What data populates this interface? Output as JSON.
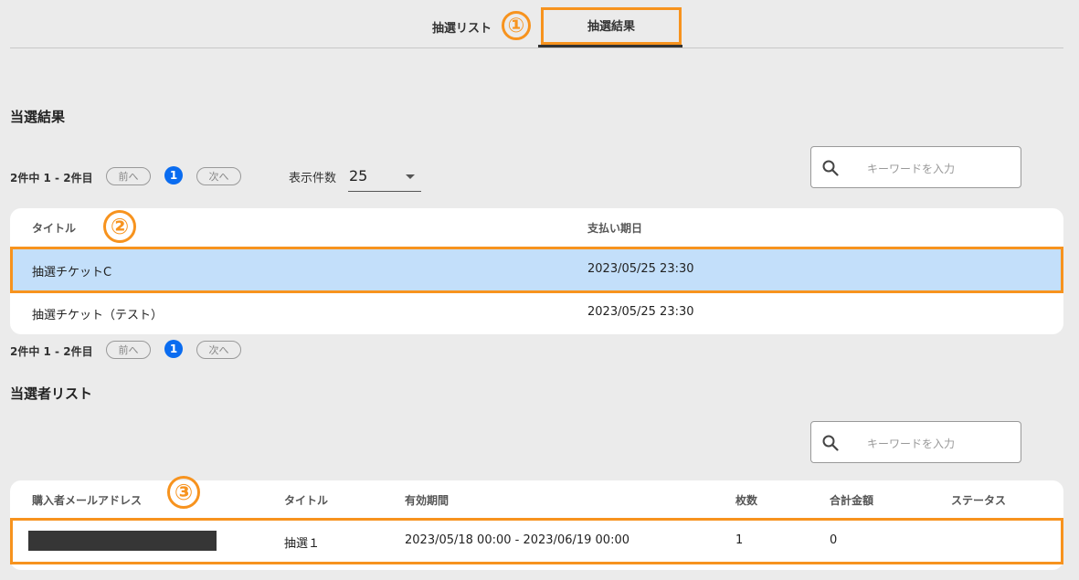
{
  "tabs": [
    {
      "label": "抽選リスト"
    },
    {
      "label": "抽選結果"
    }
  ],
  "annotations": [
    "①",
    "②",
    "③"
  ],
  "results_section": {
    "title": "当選結果",
    "pager": {
      "summary": "2件中 1 - 2件目",
      "prev": "前へ",
      "current": "1",
      "next": "次へ"
    },
    "per_page_label": "表示件数",
    "per_page_value": "25",
    "search_placeholder": "キーワードを入力",
    "columns": [
      "タイトル",
      "支払い期日"
    ],
    "rows": [
      {
        "title": "抽選チケットC",
        "due": "2023/05/25 23:30",
        "selected": true
      },
      {
        "title": "抽選チケット（テスト）",
        "due": "2023/05/25 23:30",
        "selected": false
      }
    ],
    "pager_bottom": {
      "summary": "2件中 1 - 2件目",
      "prev": "前へ",
      "current": "1",
      "next": "次へ"
    }
  },
  "winners_section": {
    "title": "当選者リスト",
    "search_placeholder": "キーワードを入力",
    "columns": [
      "購入者メールアドレス",
      "タイトル",
      "有効期間",
      "枚数",
      "合計金額",
      "ステータス"
    ],
    "rows": [
      {
        "email": "",
        "title": "抽選１",
        "period": "2023/05/18 00:00 - 2023/06/19 00:00",
        "count": "1",
        "total": "0",
        "status": ""
      }
    ]
  },
  "colors": {
    "accent_orange": "#f7931e",
    "selected_row": "#c3dffa",
    "page_dot": "#0a6cf0"
  }
}
